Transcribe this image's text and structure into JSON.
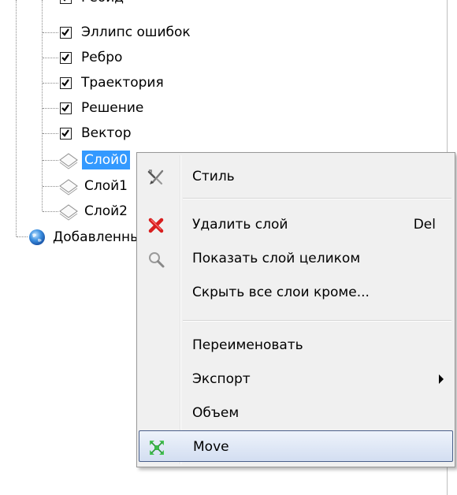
{
  "tree": {
    "top_partial_label": "Геоид",
    "items": [
      {
        "label": "Эллипс ошибок",
        "checked": true
      },
      {
        "label": "Ребро",
        "checked": true
      },
      {
        "label": "Траектория",
        "checked": true
      },
      {
        "label": "Решение",
        "checked": true
      },
      {
        "label": "Вектор",
        "checked": true
      }
    ],
    "layers": [
      {
        "label": "Слой0",
        "selected": true
      },
      {
        "label": "Слой1",
        "selected": false
      },
      {
        "label": "Слой2",
        "selected": false
      }
    ],
    "added_node": {
      "label": "Добавленные",
      "icon": "globe-icon"
    },
    "selection_color": "#3399ff"
  },
  "context_menu": {
    "items": [
      {
        "label": "Стиль",
        "icon": "style-tools-icon",
        "shortcut": ""
      },
      {
        "label": "Удалить слой",
        "icon": "delete-x-icon",
        "shortcut": "Del"
      },
      {
        "label": "Показать слой целиком",
        "icon": "magnifier-icon",
        "shortcut": ""
      },
      {
        "label": "Скрыть все слои кроме...",
        "icon": "",
        "shortcut": ""
      },
      {
        "label": "Переименовать",
        "icon": "",
        "shortcut": ""
      },
      {
        "label": "Экспорт",
        "icon": "",
        "shortcut": "",
        "submenu": true
      },
      {
        "label": "Объем",
        "icon": "",
        "shortcut": ""
      },
      {
        "label": "Move",
        "icon": "move-arrows-icon",
        "shortcut": "",
        "highlighted": true
      }
    ],
    "highlight_color": "#d3def1"
  }
}
